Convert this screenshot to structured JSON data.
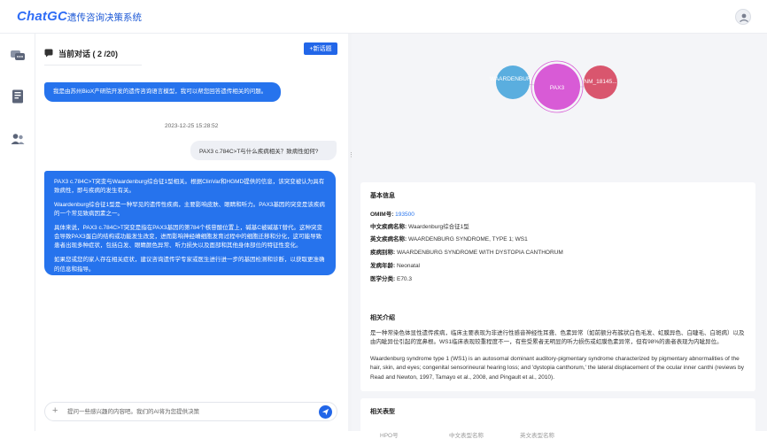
{
  "header": {
    "brand_main": "ChatGC",
    "brand_sub": "遗传咨询决策系统"
  },
  "sidebar": {
    "items": [
      {
        "icon": "chat-icon"
      },
      {
        "icon": "document-icon"
      },
      {
        "icon": "users-icon"
      }
    ]
  },
  "chat": {
    "title": "当前对话 ( 2 /20)",
    "new_button": "+新话题",
    "intro_message": "我是由苏州BioX产研院开发的遗传咨询语言模型，我可以帮您回答遗传相关的问题。",
    "timestamp": "2023-12-25 15:28:52",
    "user_message": "PAX3 c.784C>T与什么疾病相关？致病性如何?",
    "answer_paragraphs": [
      "PAX3 c.784C>T突变与Waardenburg综合征1型相关。根据ClinVar和HGMD提供的信息，该突变被认为具有致病性，即与疾病的发生有关。",
      "Waardenburg综合征1型是一种罕见的遗传性疾病，主要影响皮肤、眼睛和听力。PAX3基因的突变是该疾病的一个常见致病因素之一。",
      "具体来说，PAX3 c.784C>T突变是指在PAX3基因的第784个核苷酸位置上，碱基C被碱基T替代。这种突变会导致PAX3蛋白的结构或功能发生改变，进而影响神经嵴细胞发育过程中的细胞迁移和分化，这可能导致患者出现多种症状，包括白发、眼睛颜色异常、听力损失以及面部和其他身体部位的特征性变化。",
      "如果您或您的家人存在相关症状，建议咨询遗传学专家或医生进行进一步的基因检测和诊断，以获取更准确的信息和指导。"
    ],
    "input_placeholder": "提问一些感兴趣的内容吧。我们的AI将为您提供决策"
  },
  "graph": {
    "nodes": [
      {
        "label": "WAARDENBUR...",
        "color": "#5aaedf"
      },
      {
        "label": "PAX3",
        "color": "#d85bd6"
      },
      {
        "label": "NM_18145...",
        "color": "#d9566e"
      }
    ]
  },
  "basic_info": {
    "title": "基本信息",
    "rows": [
      {
        "key": "OMIM号:",
        "value": "193500"
      },
      {
        "key": "中文疾病名称:",
        "value": "Waardenburg综合征1型"
      },
      {
        "key": "英文疾病名称:",
        "value": "WAARDENBURG SYNDROME, TYPE 1; WS1"
      },
      {
        "key": "疾病别称:",
        "value": "WAARDENBURG SYNDROME WITH DYSTOPIA CANTHORUM"
      },
      {
        "key": "发病年龄:",
        "value": "Neonatal"
      },
      {
        "key": "医学分类:",
        "value": "E70.3"
      }
    ]
  },
  "related_intro": {
    "title": "相关介绍",
    "cn_text": "是一种常染色体显性遗传疾病，临床主要表现为非进行性感音神经性耳聋、色素异常（如前额分布簇状白色毛发、虹膜异色、白睫毛、白斑病）以及由内眦异位引起的宽鼻根。WS1临床表现较重程度不一，有些受累者无明显的听力损伤或虹膜色素异常，但有98%的患者表现为内眦异位。",
    "en_text": "Waardenburg syndrome type 1 (WS1) is an autosomal dominant auditory-pigmentary syndrome characterized by pigmentary abnormalities of the hair, skin, and eyes; congenital sensorineural hearing loss; and 'dystopia canthorum,' the lateral displacement of the ocular inner canthi (reviews by Read and Newton, 1997, Tamayo et al., 2008, and Pingault et al., 2010)."
  },
  "related_phenotype": {
    "title": "相关表型",
    "columns": [
      "HPO号",
      "中文表型名称",
      "英文表型名称"
    ]
  }
}
